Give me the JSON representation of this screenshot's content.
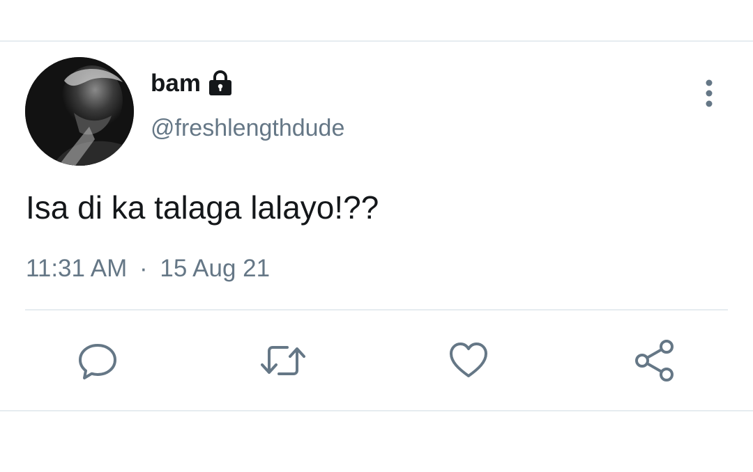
{
  "tweet": {
    "display_name": "bam",
    "handle": "@freshlengthdude",
    "text": "Isa di ka talaga lalayo!??",
    "time": "11:31 AM",
    "separator": "·",
    "date": "15 Aug 21",
    "protected_icon": "lock-icon",
    "avatar_alt": "profile photo"
  },
  "actions": [
    {
      "name": "reply",
      "icon": "reply-icon"
    },
    {
      "name": "retweet",
      "icon": "retweet-icon"
    },
    {
      "name": "like",
      "icon": "heart-icon"
    },
    {
      "name": "share",
      "icon": "share-icon"
    }
  ],
  "menu": {
    "icon": "more-vertical-icon"
  },
  "colors": {
    "text_primary": "#14171a",
    "text_secondary": "#657786",
    "icon": "#657786",
    "divider": "#e6ecf0",
    "background": "#ffffff"
  }
}
